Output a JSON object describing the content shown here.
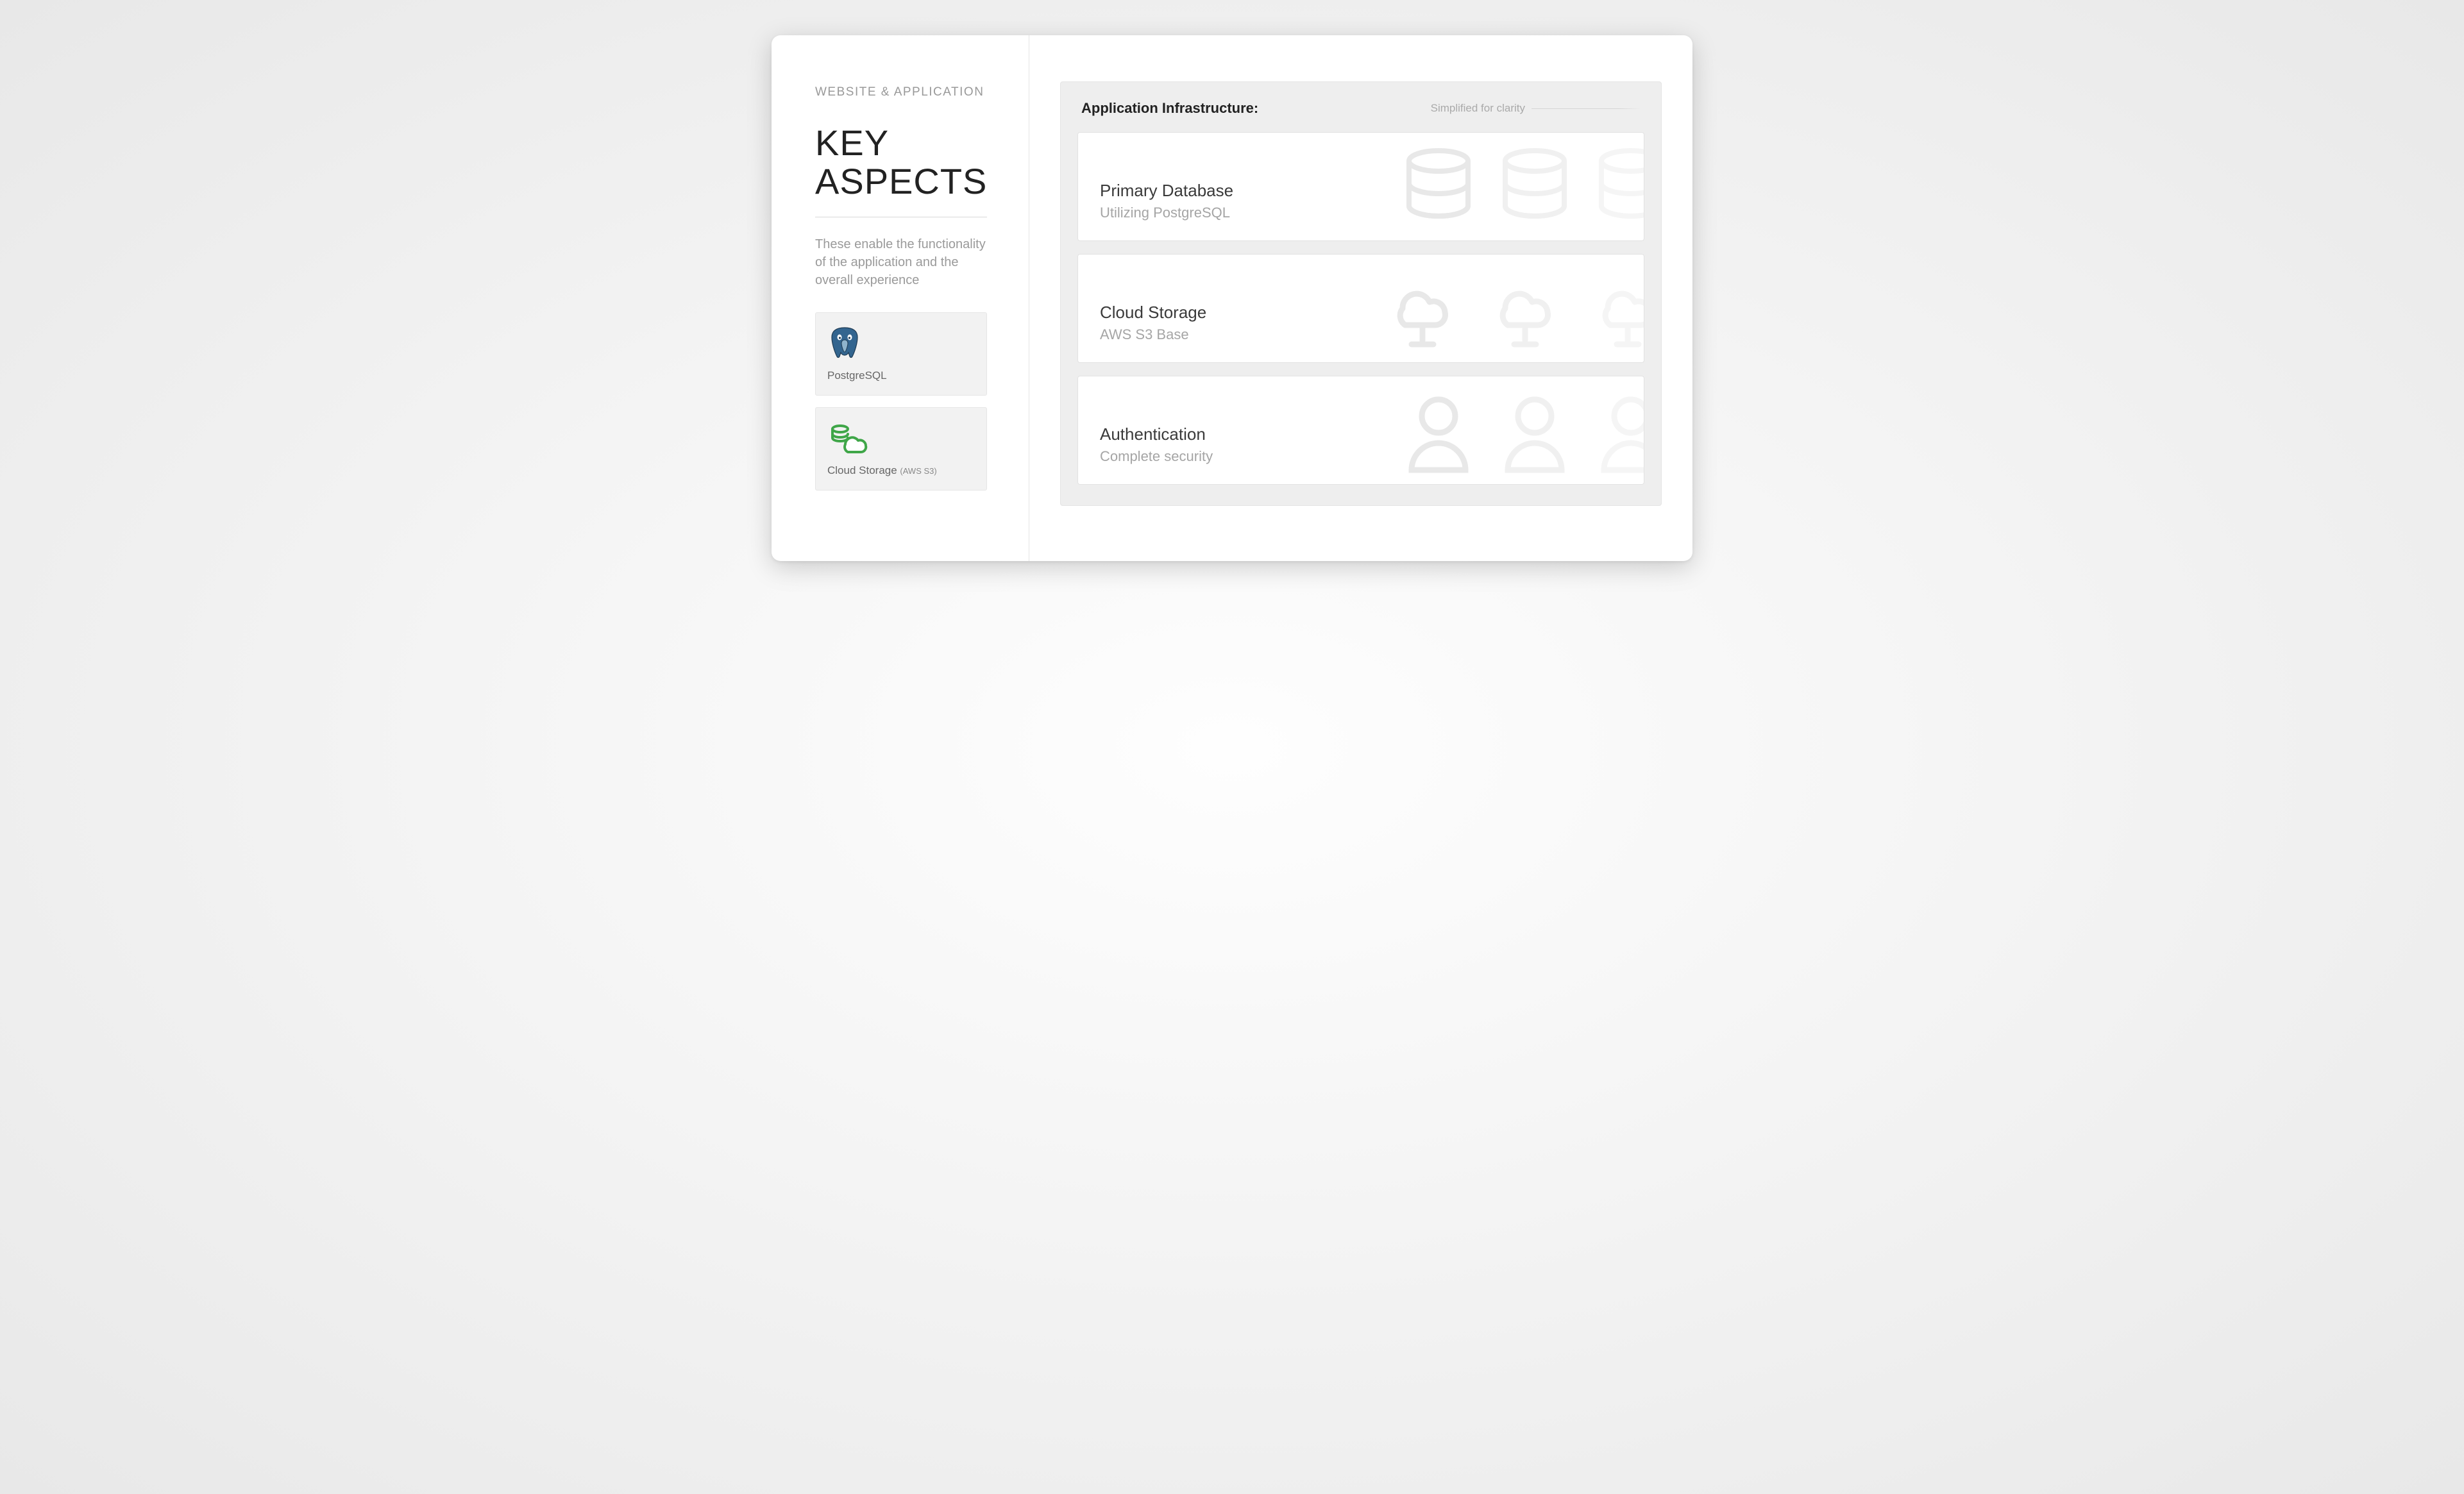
{
  "left": {
    "eyebrow": "WEBSITE & APPLICATION",
    "headline_line1": "KEY",
    "headline_line2": "ASPECTS",
    "lede": "These enable the functionality of the application and the overall experience",
    "tiles": [
      {
        "label": "PostgreSQL",
        "sub": ""
      },
      {
        "label": "Cloud Storage ",
        "sub": "(AWS S3)"
      }
    ]
  },
  "panel": {
    "title": "Application Infrastructure:",
    "note": "Simplified for clarity",
    "rows": [
      {
        "title": "Primary Database",
        "subtitle": "Utilizing PostgreSQL"
      },
      {
        "title": "Cloud Storage",
        "subtitle": "AWS S3 Base"
      },
      {
        "title": "Authentication",
        "subtitle": "Complete security"
      }
    ]
  },
  "colors": {
    "postgres": "#33658f",
    "cloud_green": "#3fa648",
    "ghost": "#ececec"
  }
}
